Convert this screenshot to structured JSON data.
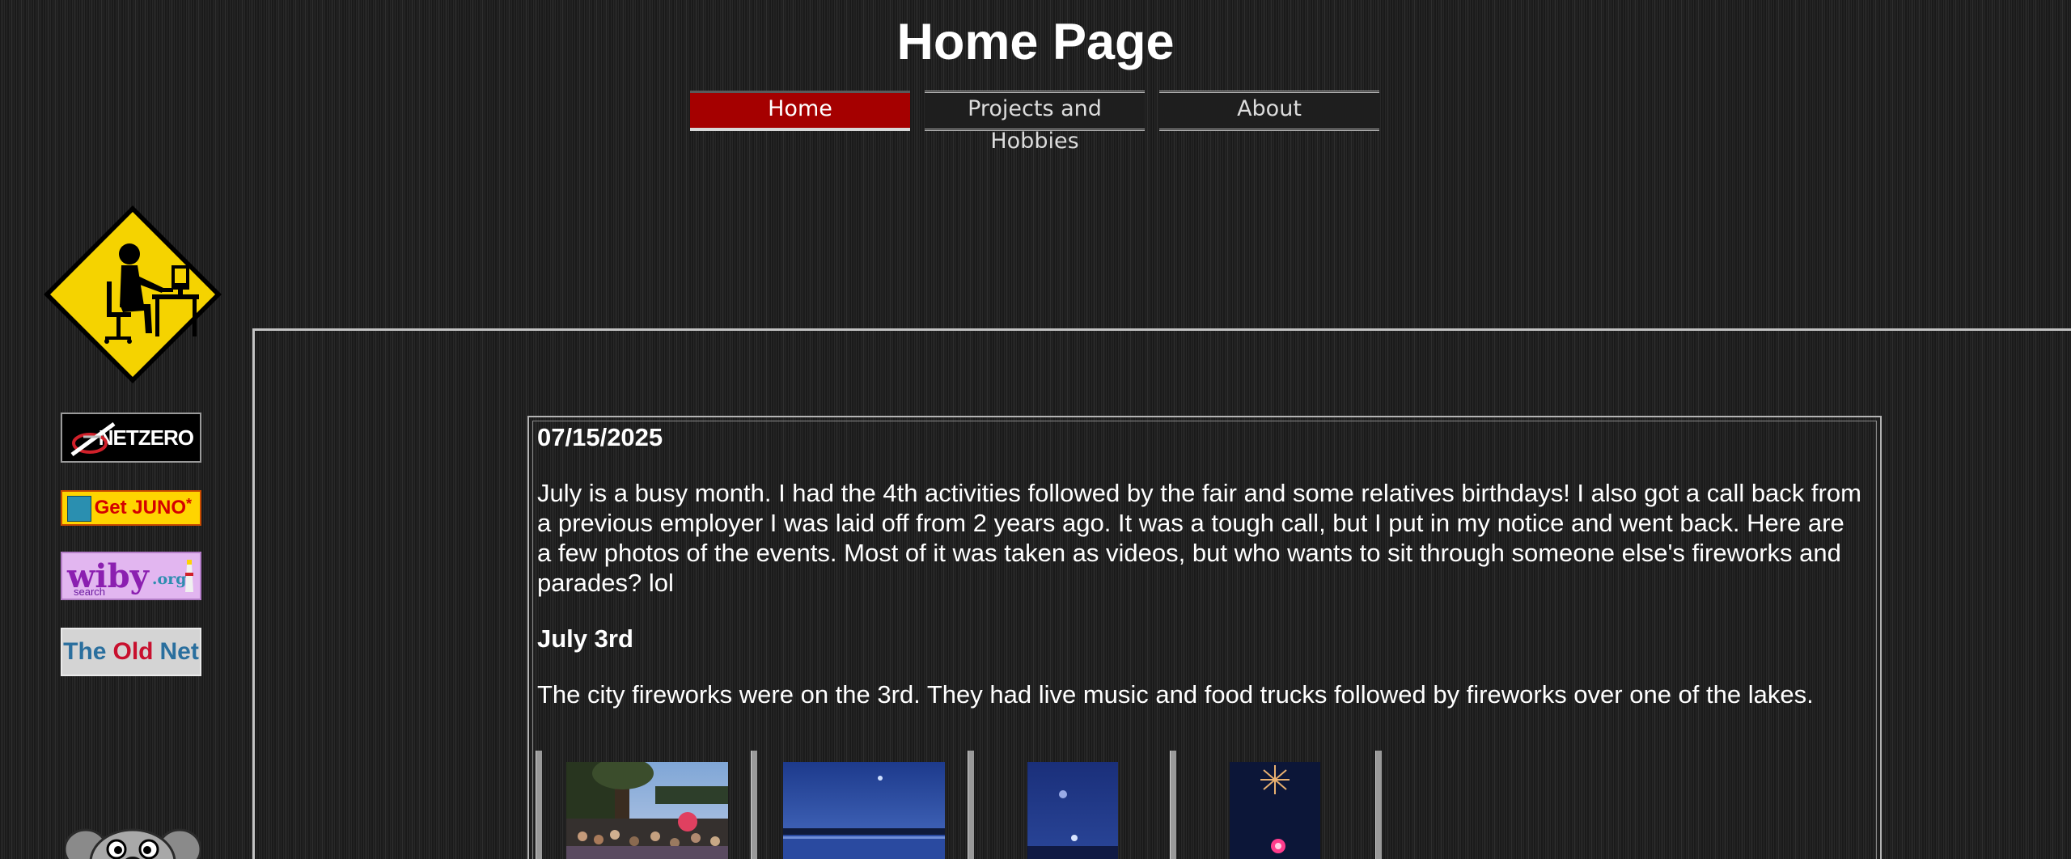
{
  "header": {
    "title": "Home Page"
  },
  "nav": {
    "items": [
      {
        "label": "Home",
        "active": true
      },
      {
        "label": "Projects and Hobbies",
        "active": false
      },
      {
        "label": "About",
        "active": false
      }
    ],
    "active_color": "#a50000"
  },
  "sidebar": {
    "logo": "person-at-computer-warning-sign-icon",
    "badges": [
      {
        "name": "netzero",
        "text": "NETZERO"
      },
      {
        "name": "juno",
        "text": "Get JUNO"
      },
      {
        "name": "wiby",
        "text": "wiby",
        "suffix": ".org",
        "sub": "search"
      },
      {
        "name": "oldnet",
        "text_a": "The",
        "text_b": "Old",
        "text_c": "Net"
      }
    ]
  },
  "post": {
    "date": "07/15/2025",
    "intro": "July is a busy month. I had the 4th activities followed by the fair and some relatives birthdays! I also got a call back from a previous employer I was laid off from 2 years ago. It was a tough call, but I put in my notice and went back. Here are a few photos of the events. Most of it was taken as videos, but who wants to sit through someone else's fireworks and parades? lol",
    "section_heading": "July 3rd",
    "section_text": "The city fireworks were on the 3rd. They had live music and food trucks followed by fireworks over one of the lakes.",
    "photos": [
      {
        "name": "photo-crowd-lake"
      },
      {
        "name": "photo-lake-dusk"
      },
      {
        "name": "photo-firework-night"
      },
      {
        "name": "photo-firework-burst"
      }
    ]
  },
  "colors": {
    "background": "#1c1c1c",
    "text": "#ffffff",
    "sign_yellow": "#f5d300"
  }
}
